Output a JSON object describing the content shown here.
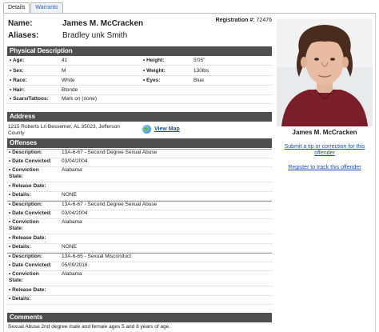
{
  "tabs": [
    {
      "label": "Details",
      "active": true
    },
    {
      "label": "Warrants",
      "active": false
    }
  ],
  "header": {
    "name_label": "Name:",
    "name": "James M. McCracken",
    "aliases_label": "Aliases:",
    "aliases": "Bradley unk Smith",
    "registration_label": "Registration #:",
    "registration": "72476"
  },
  "physical": {
    "title": "Physical Description",
    "left": [
      {
        "label": "• Age:",
        "value": "41"
      },
      {
        "label": "• Sex:",
        "value": "M"
      },
      {
        "label": "• Race:",
        "value": "White"
      },
      {
        "label": "• Hair:",
        "value": "Blonde"
      },
      {
        "label": "• Scars/Tattoos:",
        "value": "Mark on (none)"
      }
    ],
    "right": [
      {
        "label": "• Height:",
        "value": "5'05\""
      },
      {
        "label": "• Weight:",
        "value": "130lbs"
      },
      {
        "label": "• Eyes:",
        "value": "Blue"
      }
    ]
  },
  "address": {
    "title": "Address",
    "line1": "1215 Roberts Ln Bessemer, AL 35023, Jefferson",
    "line2": "County",
    "view_map": "View Map"
  },
  "offenses": {
    "title": "Offenses",
    "labels": {
      "description": "• Description:",
      "date_convicted": "• Date Convicted:",
      "conviction_state_1": "• Conviction",
      "conviction_state_2": "State:",
      "release_date": "• Release Date:",
      "details": "• Details:"
    },
    "items": [
      {
        "description": "13A-6-67 - Second Degree Sexual Abuse",
        "date_convicted": "03/04/2004",
        "conviction_state": "Alabama",
        "release_date": "",
        "details": "NONE"
      },
      {
        "description": "13A-6-67 - Second Degree Sexual Abuse",
        "date_convicted": "03/04/2004",
        "conviction_state": "Alabama",
        "release_date": "",
        "details": "NONE"
      },
      {
        "description": "13A-6-65 - Sexual Misconduct",
        "date_convicted": "05/09/2016",
        "conviction_state": "Alabama",
        "release_date": "",
        "details": ""
      }
    ]
  },
  "comments": {
    "title": "Comments",
    "text": "Sexual Abuse 2nd degree male and female ages 5 and 8 years of age."
  },
  "sidebar": {
    "name": "James M. McCracken",
    "tip_link_1": "Submit a tip or correction for this",
    "tip_link_2": "offender",
    "track_link": "Register to track this offender"
  },
  "colors": {
    "section_bar": "#4f4f4f",
    "link": "#1f4fb0",
    "photo_shirt": "#7a1f2a"
  }
}
